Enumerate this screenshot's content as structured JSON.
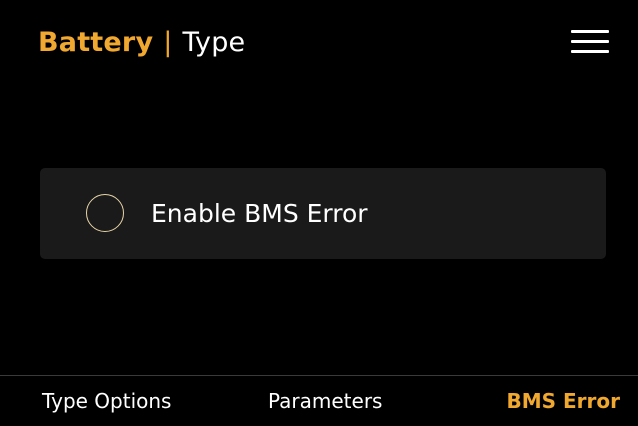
{
  "header": {
    "section": "Battery",
    "separator": "|",
    "page": "Type",
    "menu_icon": "hamburger-menu-icon"
  },
  "option": {
    "label": "Enable BMS Error",
    "checked": false
  },
  "tabs": [
    {
      "label": "Type Options",
      "active": false
    },
    {
      "label": "Parameters",
      "active": false
    },
    {
      "label": "BMS Error",
      "active": true
    }
  ],
  "colors": {
    "background": "#000000",
    "accent": "#f0a830",
    "card": "#1a1a1a",
    "radio_border": "#e8d4a8",
    "divider": "#3a3a3a"
  }
}
